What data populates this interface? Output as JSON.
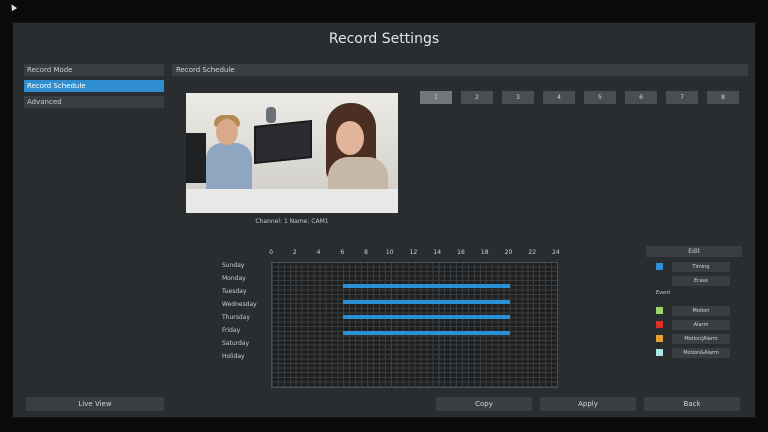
{
  "window": {
    "title": "Record Settings"
  },
  "sidebar": {
    "items": [
      {
        "label": "Record Mode"
      },
      {
        "label": "Record Schedule"
      },
      {
        "label": "Advanced"
      }
    ],
    "live_view": "Live View"
  },
  "section": {
    "label": "Record Schedule"
  },
  "preview": {
    "caption": "Channel: 1 Name: CAM1"
  },
  "channels": [
    {
      "label": "1",
      "selected": true
    },
    {
      "label": "2"
    },
    {
      "label": "3"
    },
    {
      "label": "4"
    },
    {
      "label": "5"
    },
    {
      "label": "6"
    },
    {
      "label": "7"
    },
    {
      "label": "8"
    }
  ],
  "schedule": {
    "hours": [
      "0",
      "2",
      "4",
      "6",
      "8",
      "10",
      "12",
      "14",
      "16",
      "18",
      "20",
      "22",
      "24"
    ],
    "days": [
      "Sunday",
      "Monday",
      "Tuesday",
      "Wednesday",
      "Thursday",
      "Friday",
      "Saturday",
      "Holiday"
    ],
    "recordings": [
      {
        "day": "Monday",
        "start": 6,
        "end": 20,
        "type": "Timing"
      },
      {
        "day": "Tuesday",
        "start": 6,
        "end": 20,
        "type": "Timing"
      },
      {
        "day": "Wednesday",
        "start": 6,
        "end": 20,
        "type": "Timing"
      },
      {
        "day": "Thursday",
        "start": 6,
        "end": 20,
        "type": "Timing"
      }
    ]
  },
  "legend": {
    "edit": "Edit",
    "timing": "Timing",
    "erase": "Erase",
    "event": "Event",
    "motion": "Motion",
    "alarm": "Alarm",
    "motion_or_alarm": "Motion|Alarm",
    "motion_and_alarm": "Motion&Alarm"
  },
  "colors": {
    "timing": "#2a8fd7",
    "motion": "#9fd36b",
    "alarm": "#d9322b",
    "motion_or_alarm": "#e8a13a",
    "motion_and_alarm": "#a9e6e4",
    "selected": "#2f8ecf"
  },
  "buttons": {
    "copy": "Copy",
    "apply": "Apply",
    "back": "Back"
  }
}
